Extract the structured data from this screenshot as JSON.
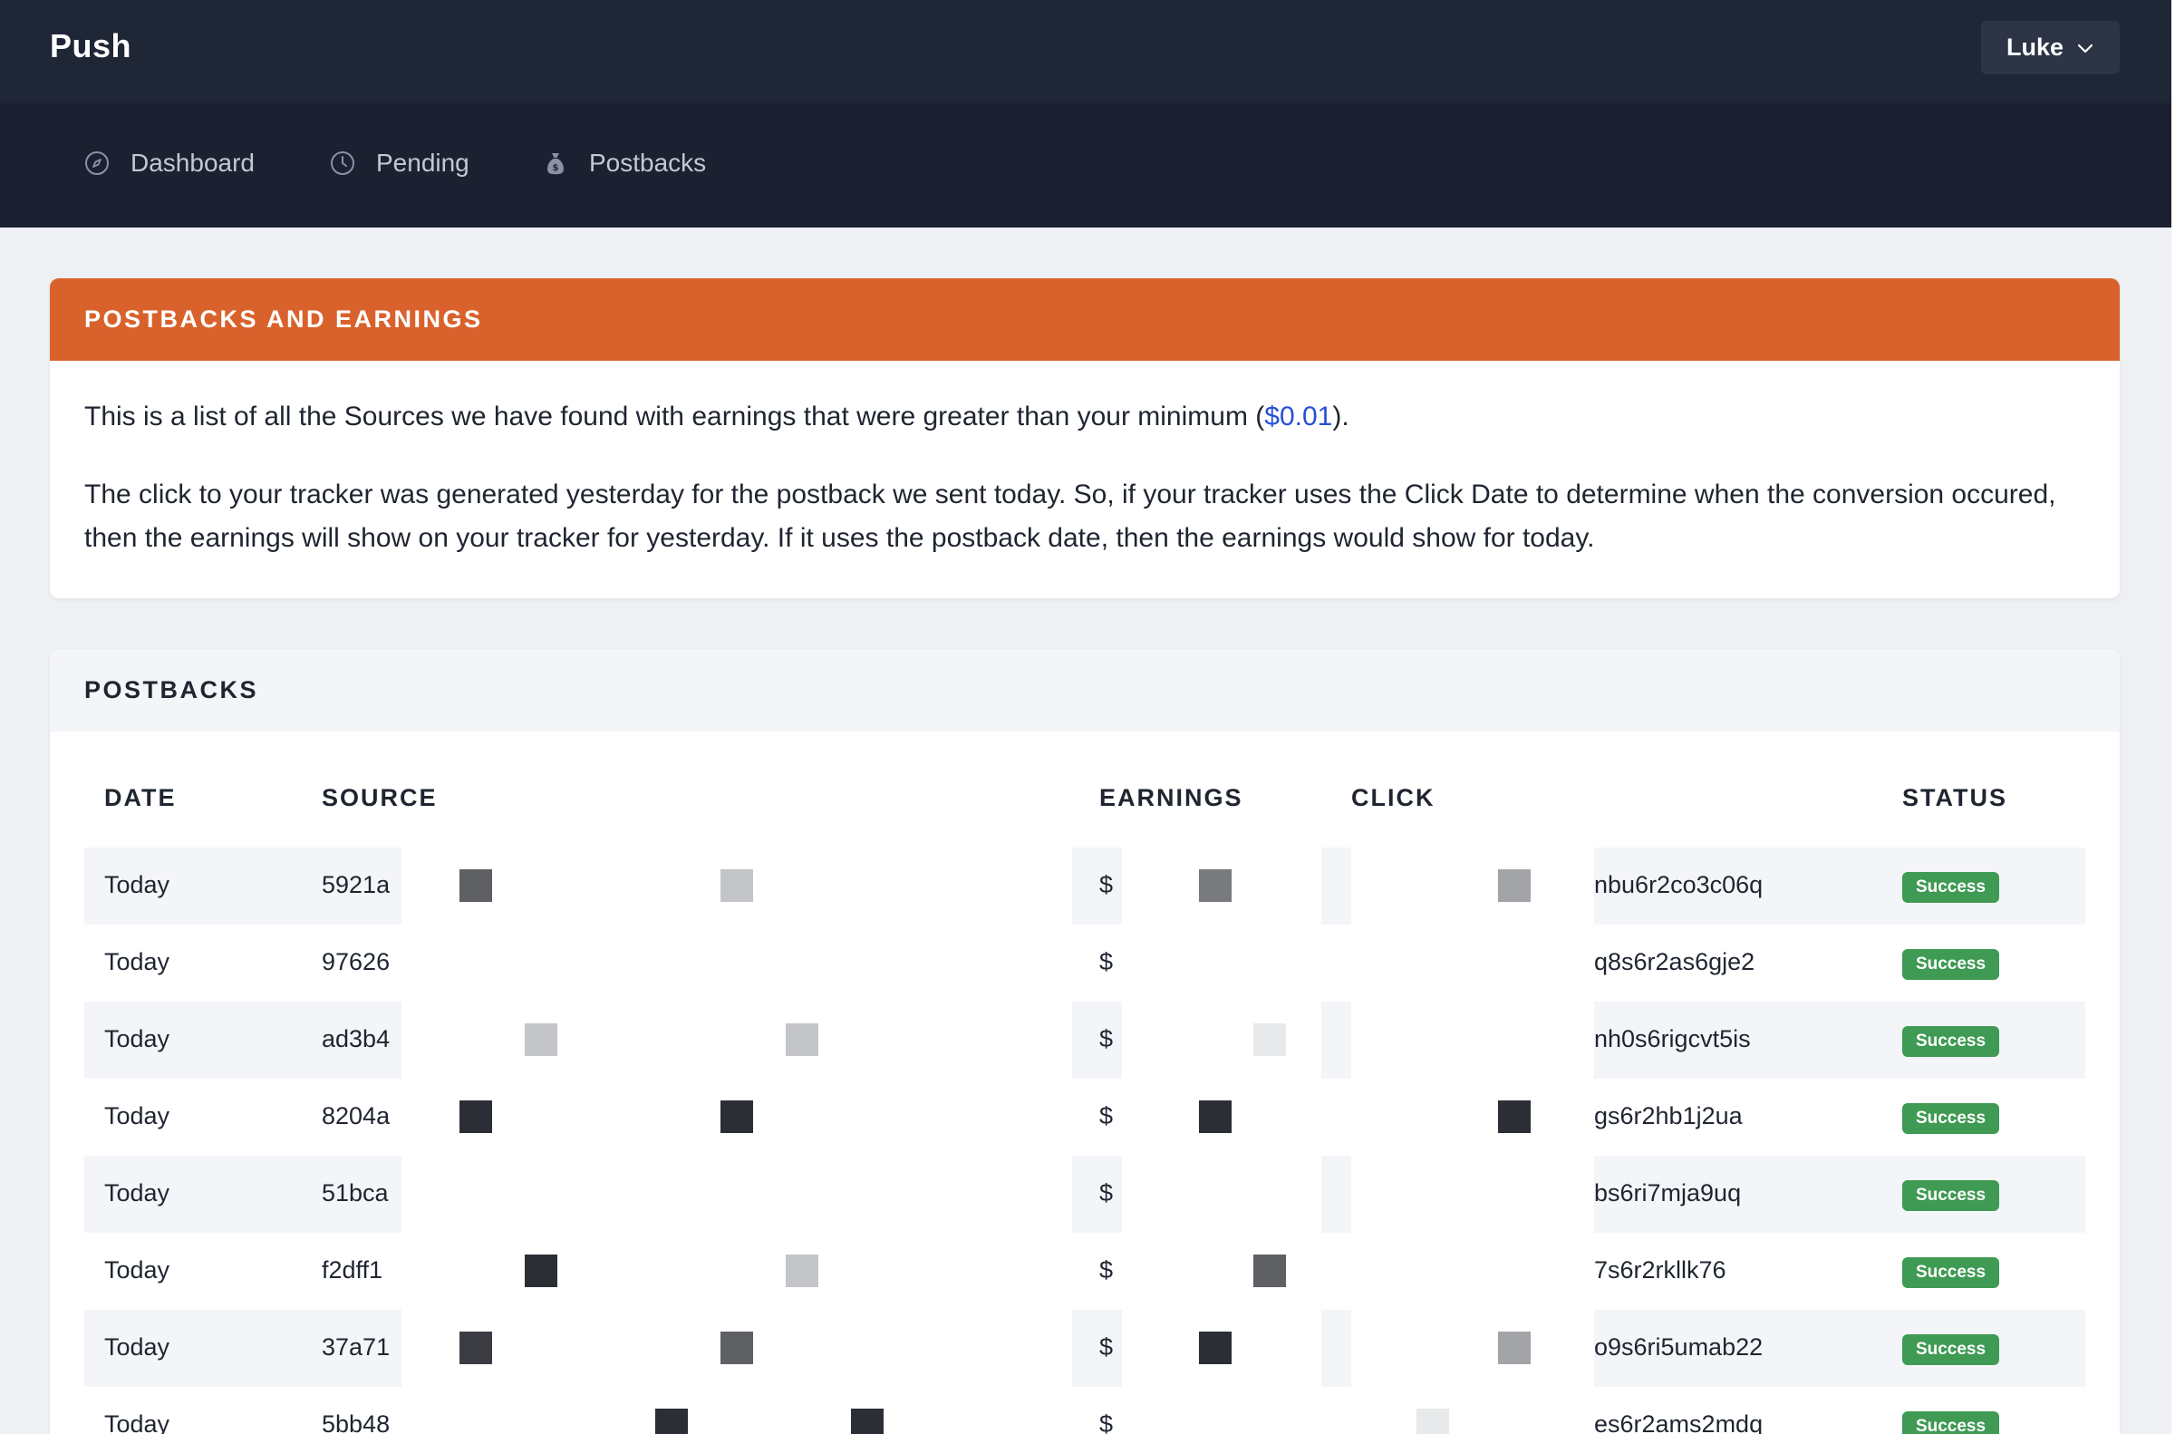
{
  "app": {
    "brand": "Push",
    "user": "Luke"
  },
  "nav": [
    {
      "label": "Dashboard",
      "icon": "compass-icon"
    },
    {
      "label": "Pending",
      "icon": "clock-icon"
    },
    {
      "label": "Postbacks",
      "icon": "money-bag-icon"
    }
  ],
  "info_card": {
    "title": "POSTBACKS AND EARNINGS",
    "p1_before": "This is a list of all the Sources we have found with earnings that were greater than your minimum (",
    "p1_link": "$0.01",
    "p1_after": ").",
    "p2": "The click to your tracker was generated yesterday for the postback we sent today. So, if your tracker uses the Click Date to determine when the conversion occured, then the earnings will show on your tracker for yesterday. If it uses the postback date, then the earnings would show for today."
  },
  "table_card": {
    "title": "POSTBACKS",
    "headers": {
      "date": "DATE",
      "source": "SOURCE",
      "earnings": "EARNINGS",
      "click": "CLICK",
      "status": "STATUS"
    },
    "rows": [
      {
        "date": "Today",
        "source": "5921a",
        "earnings": "$",
        "click": "nbu6r2co3c06q",
        "status": "Success"
      },
      {
        "date": "Today",
        "source": "97626",
        "earnings": "$",
        "click": "q8s6r2as6gje2",
        "status": "Success"
      },
      {
        "date": "Today",
        "source": "ad3b4",
        "earnings": "$",
        "click": "nh0s6rigcvt5is",
        "status": "Success"
      },
      {
        "date": "Today",
        "source": "8204a",
        "earnings": "$",
        "click": "gs6r2hb1j2ua",
        "status": "Success"
      },
      {
        "date": "Today",
        "source": "51bca",
        "earnings": "$",
        "click": "bs6ri7mja9uq",
        "status": "Success"
      },
      {
        "date": "Today",
        "source": "f2dff1",
        "earnings": "$",
        "click": "7s6r2rkllk76",
        "status": "Success"
      },
      {
        "date": "Today",
        "source": "37a71",
        "earnings": "$",
        "click": "o9s6ri5umab22",
        "status": "Success"
      },
      {
        "date": "Today",
        "source": "5bb48",
        "earnings": "$",
        "click": "es6r2ams2mdq",
        "status": "Success"
      }
    ]
  }
}
